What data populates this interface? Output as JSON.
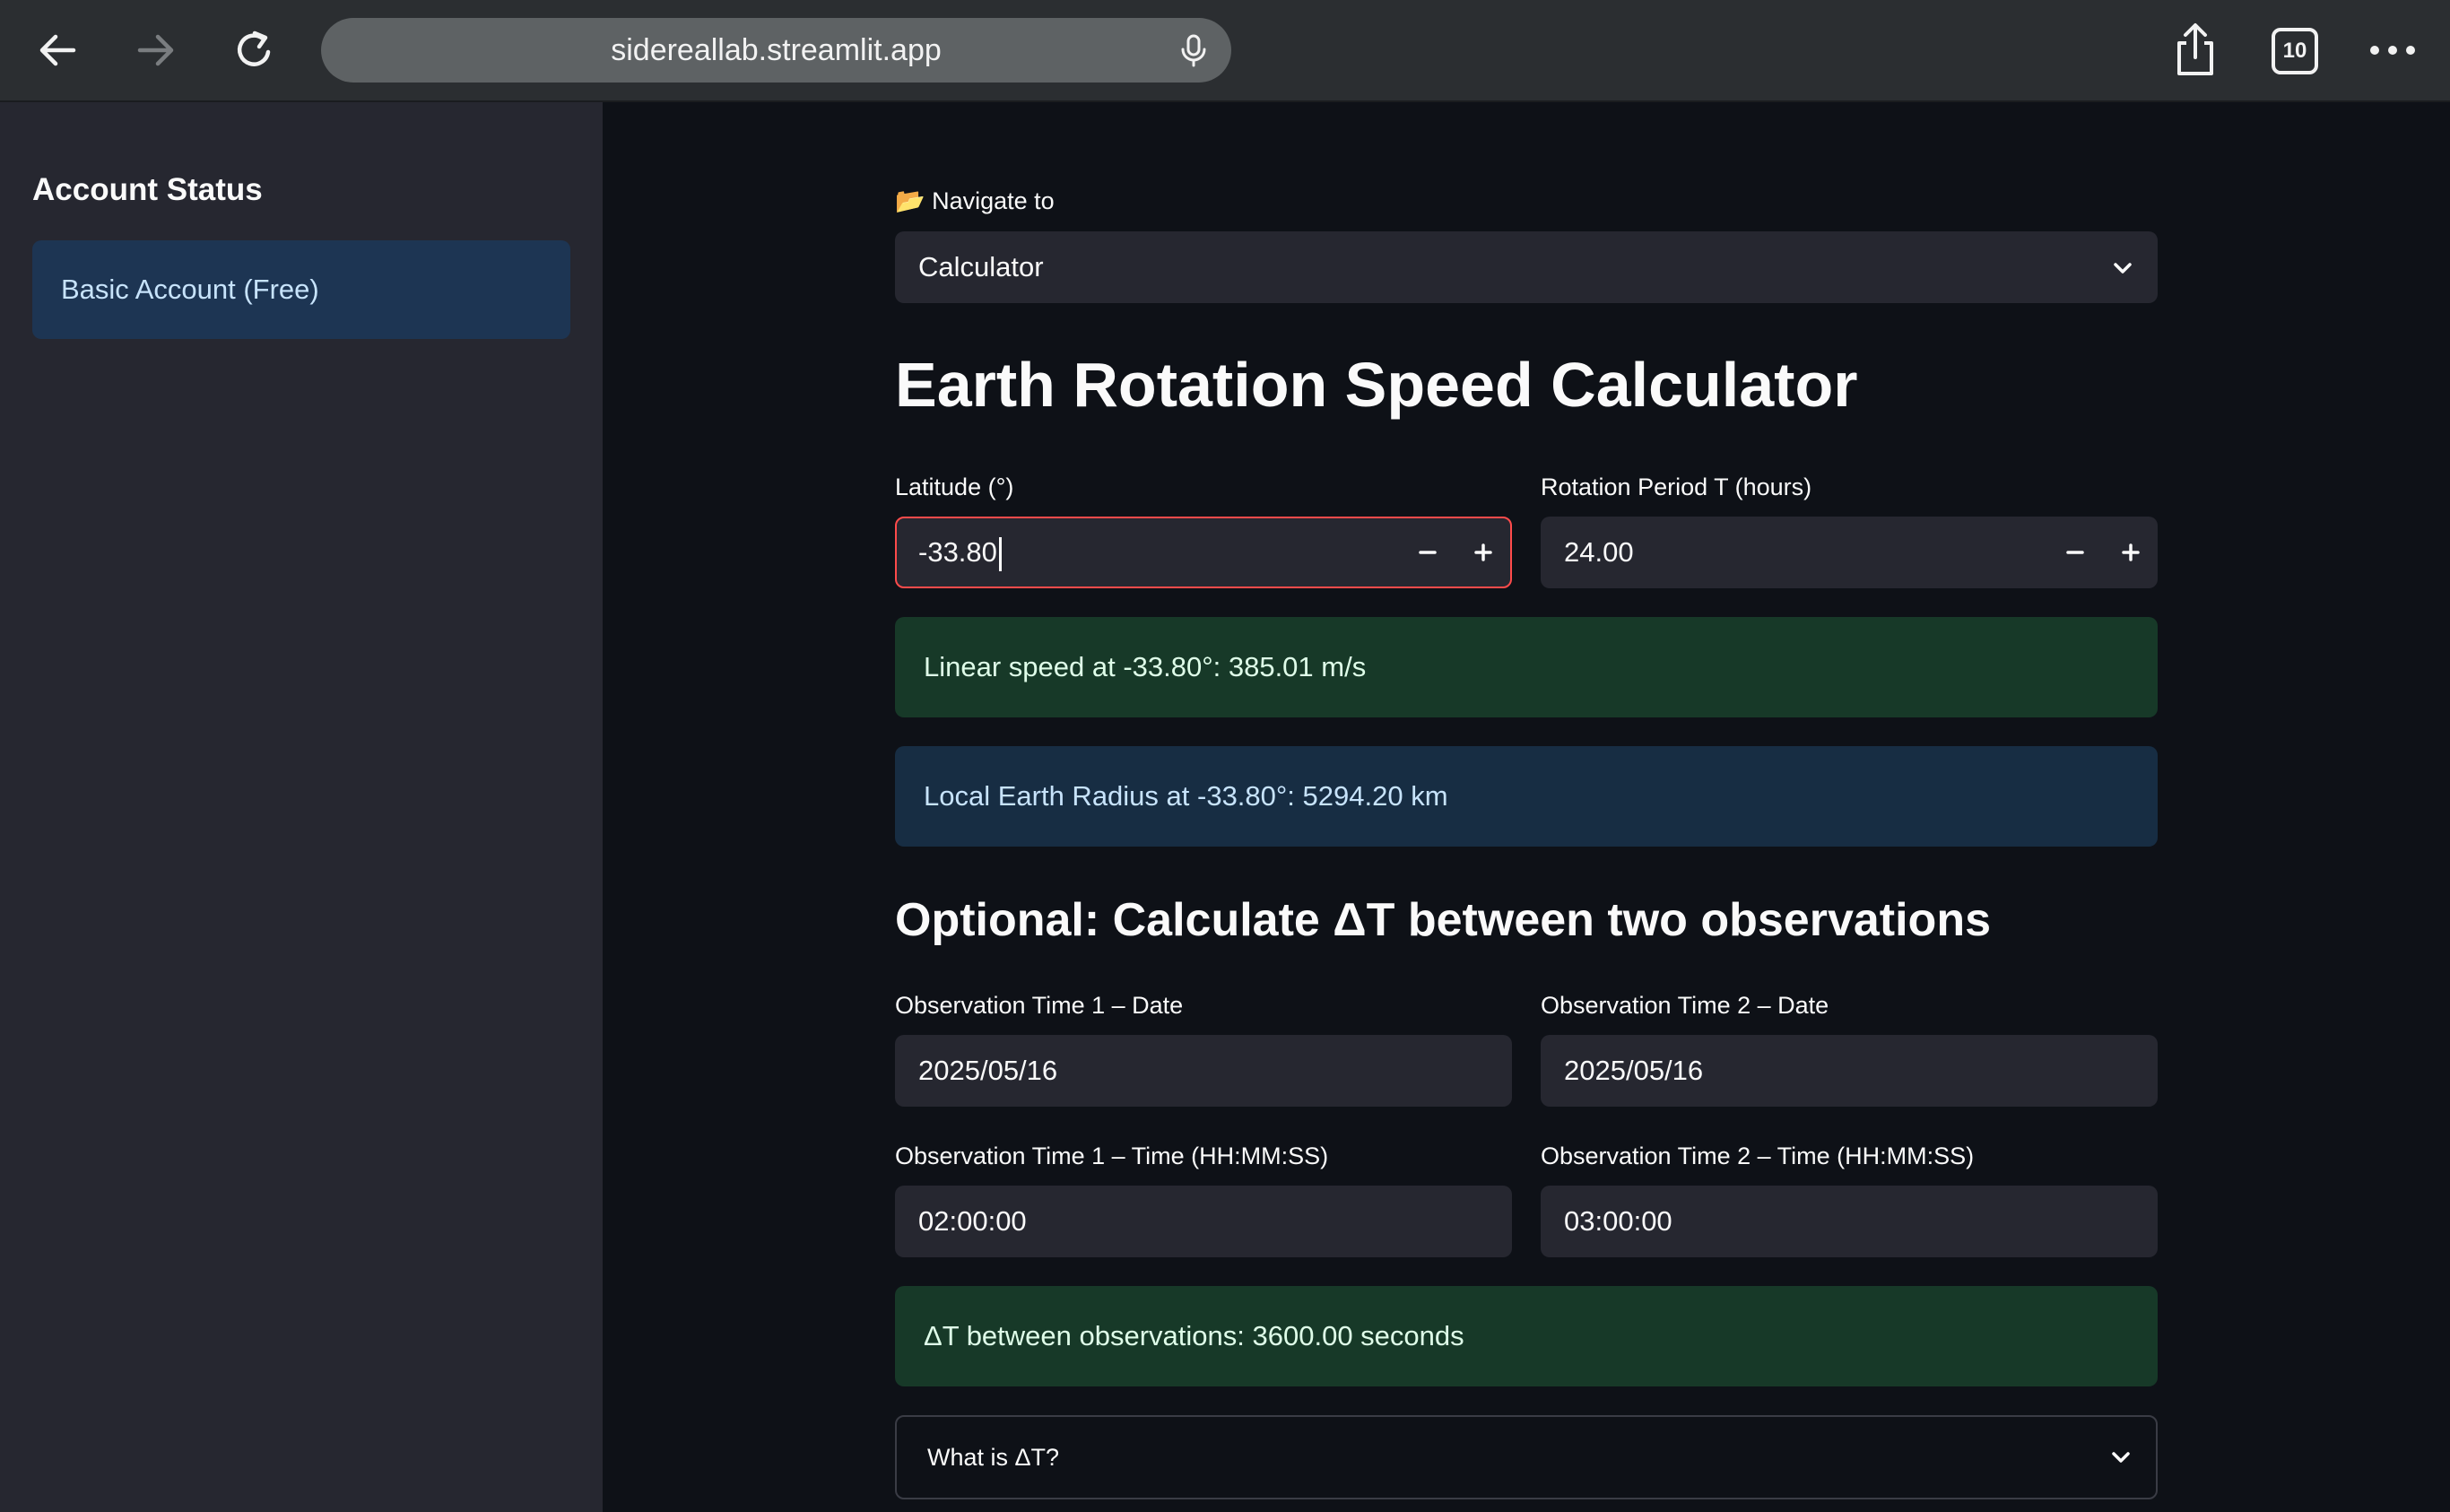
{
  "browser": {
    "url": "sidereallab.streamlit.app",
    "tab_count": "10",
    "icons": [
      "back-arrow-icon",
      "forward-arrow-icon",
      "reload-icon",
      "microphone-icon",
      "share-icon",
      "tabs-icon",
      "more-icon"
    ]
  },
  "sidebar": {
    "title": "Account Status",
    "account_status": "Basic Account (Free)"
  },
  "main": {
    "nav_label": "📂 Navigate to",
    "nav_selected": "Calculator",
    "title": "Earth Rotation Speed Calculator",
    "latitude_label": "Latitude (°)",
    "latitude_value": "-33.80",
    "period_label": "Rotation Period T (hours)",
    "period_value": "24.00",
    "linear_speed": "Linear speed at -33.80°: 385.01 m/s",
    "local_radius": "Local Earth Radius at -33.80°: 5294.20 km",
    "subtitle": "Optional: Calculate ΔT between two observations",
    "obs1_date_label": "Observation Time 1 – Date",
    "obs1_date": "2025/05/16",
    "obs2_date_label": "Observation Time 2 – Date",
    "obs2_date": "2025/05/16",
    "obs1_time_label": "Observation Time 1 – Time (HH:MM:SS)",
    "obs1_time": "02:00:00",
    "obs2_time_label": "Observation Time 2 – Time (HH:MM:SS)",
    "obs2_time": "03:00:00",
    "delta_t": "ΔT between observations: 3600.00 seconds",
    "expander_label": "What is ΔT?"
  },
  "colors": {
    "background": "#0e1117",
    "sidebar": "#262730",
    "input": "#262730",
    "focus_border": "#ff4b4b",
    "success_bg": "#173928",
    "info_bg": "#172d43"
  }
}
